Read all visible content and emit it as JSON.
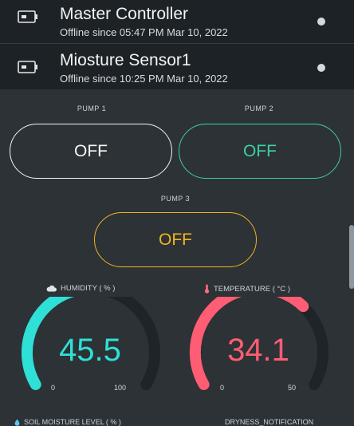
{
  "devices": [
    {
      "name": "Master Controller",
      "status": "Offline since 05:47 PM Mar 10, 2022"
    },
    {
      "name": "Miosture Sensor1",
      "status": "Offline since 10:25 PM Mar 10, 2022"
    }
  ],
  "pumps": [
    {
      "label": "PUMP 1",
      "state": "OFF",
      "color": "#f4f6f7"
    },
    {
      "label": "PUMP 2",
      "state": "OFF",
      "color": "#3fd1a5"
    },
    {
      "label": "PUMP 3",
      "state": "OFF",
      "color": "#f2b51e"
    }
  ],
  "gauges": [
    {
      "title": "HUMIDITY ( % )",
      "value": "45.5",
      "value_num": 45.5,
      "min": "0",
      "max": "100",
      "min_num": 0,
      "max_num": 100,
      "color": "#2fe0d6",
      "icon": "cloud-icon"
    },
    {
      "title": "TEMPERATURE ( °C )",
      "value": "34.1",
      "value_num": 34.1,
      "min": "0",
      "max": "50",
      "min_num": 0,
      "max_num": 50,
      "color": "#ff5d73",
      "icon": "thermometer-icon"
    }
  ],
  "bottom_labels": {
    "soil_moisture": "SOIL MOISTURE LEVEL ( % )",
    "dryness": "DRYNESS_NOTIFICATION"
  },
  "colors": {
    "header_bg": "#1d2226",
    "page_bg": "#2c3236",
    "gauge_track": "#1e2428"
  }
}
